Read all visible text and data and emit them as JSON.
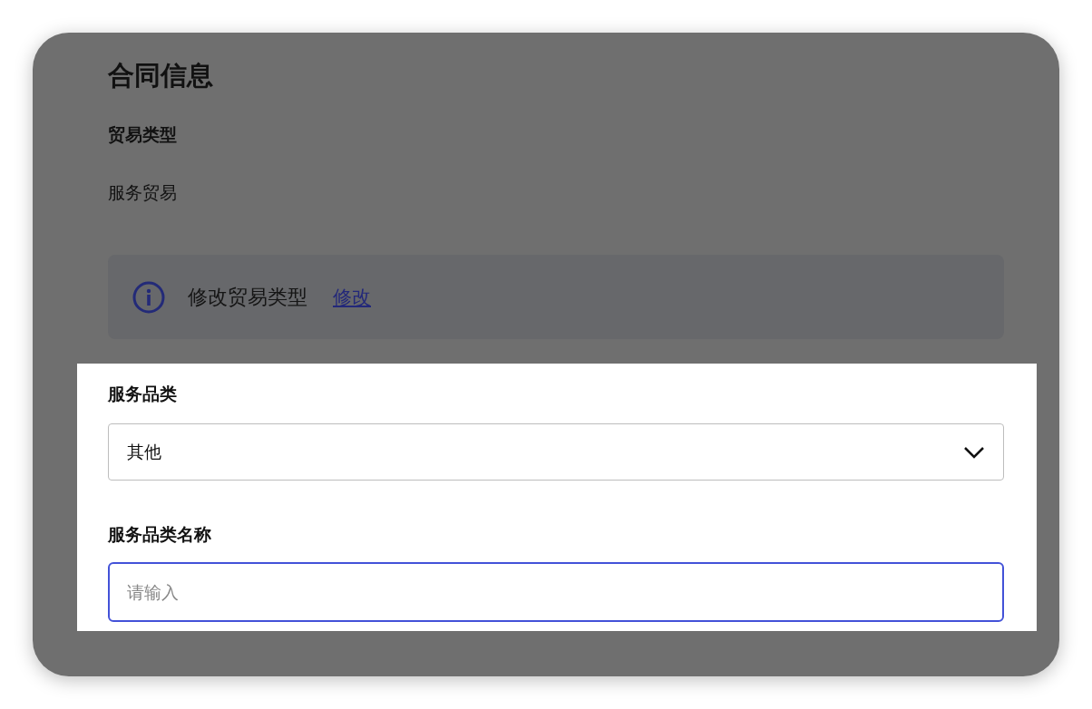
{
  "section_title": "合同信息",
  "trade_type": {
    "label": "贸易类型",
    "value": "服务贸易"
  },
  "notice": {
    "text": "修改贸易类型",
    "link": "修改"
  },
  "highlight": {
    "category": {
      "label": "服务品类",
      "value": "其他"
    },
    "category_name": {
      "label": "服务品类名称",
      "placeholder": "请输入",
      "focused": true
    }
  }
}
